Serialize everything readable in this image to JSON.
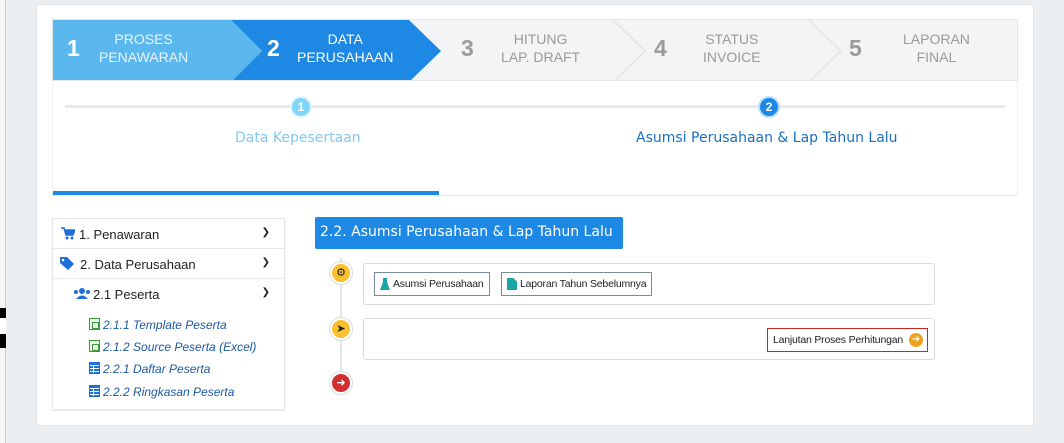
{
  "wizard": {
    "steps": [
      {
        "num": "1",
        "label": "PROSES\nPENAWARAN",
        "state": "done"
      },
      {
        "num": "2",
        "label": "DATA\nPERUSAHAAN",
        "state": "active"
      },
      {
        "num": "3",
        "label": "HITUNG\nLAP. DRAFT",
        "state": "pending"
      },
      {
        "num": "4",
        "label": "STATUS\nINVOICE",
        "state": "pending"
      },
      {
        "num": "5",
        "label": "LAPORAN\nFINAL",
        "state": "pending"
      }
    ],
    "colors": {
      "done": "#5bb8ef",
      "active": "#1e88e5",
      "pending": "#f3f4f5"
    }
  },
  "substeps": [
    {
      "num": "1",
      "label": "Data Kepesertaan"
    },
    {
      "num": "2",
      "label": "Asumsi Perusahaan & Lap Tahun Lalu"
    }
  ],
  "menu": {
    "items": [
      {
        "label": "1. Penawaran",
        "icon": "cart-icon"
      },
      {
        "label": "2. Data Perusahaan",
        "icon": "tags-icon"
      },
      {
        "label": "2.1 Peserta",
        "icon": "users-icon"
      }
    ],
    "sublinks": [
      {
        "label": "2.1.1 Template Peserta",
        "icon": "excel-file-icon"
      },
      {
        "label": "2.1.2 Source Peserta (Excel)",
        "icon": "excel-file-icon"
      },
      {
        "label": "2.2.1 Daftar Peserta",
        "icon": "table-icon"
      },
      {
        "label": "2.2.2 Ringkasan Peserta",
        "icon": "table-icon"
      }
    ]
  },
  "content": {
    "title": "2.2. Asumsi Perusahaan & Lap Tahun Lalu",
    "buttons": {
      "asumsi": "Asumsi Perusahaan",
      "laporan": "Laporan Tahun Sebelumnya",
      "lanjutan": "Lanjutan Proses Perhitungan"
    }
  }
}
